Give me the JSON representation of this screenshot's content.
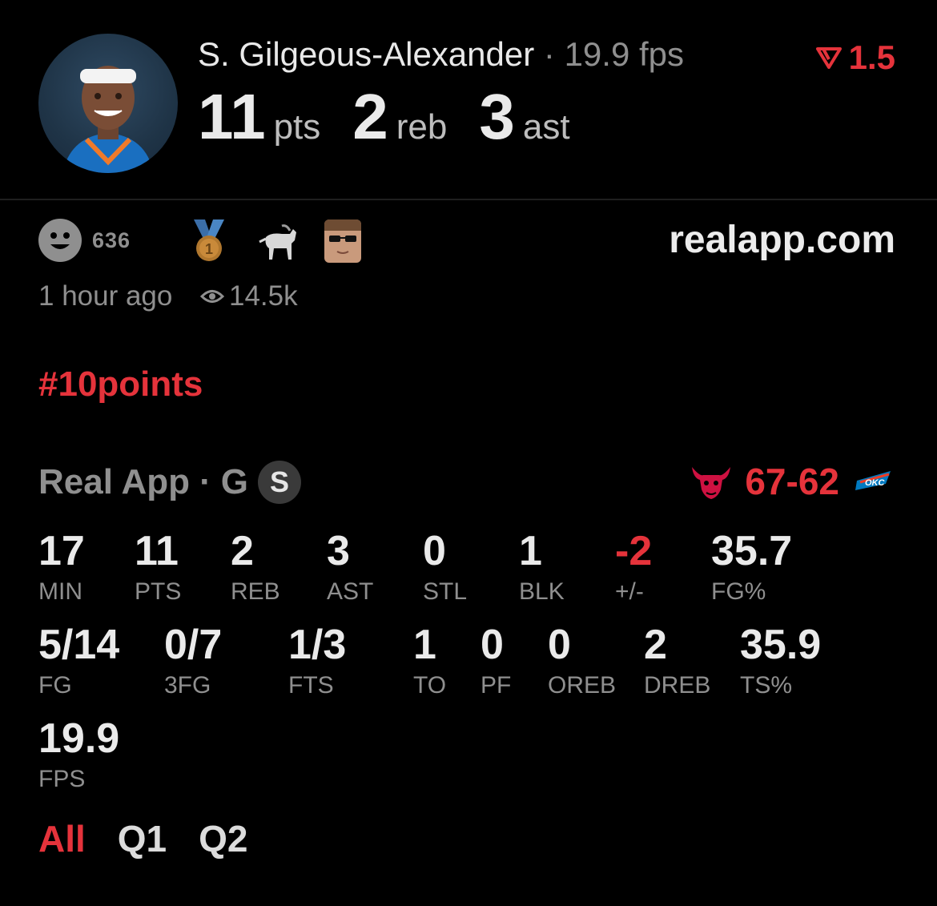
{
  "header": {
    "player_name": "S. Gilgeous-Alexander",
    "separator": "·",
    "fps_text": "19.9 fps",
    "delta": "1.5",
    "big_stats": [
      {
        "value": "11",
        "unit": "pts"
      },
      {
        "value": "2",
        "unit": "reb"
      },
      {
        "value": "3",
        "unit": "ast"
      }
    ]
  },
  "reactions": {
    "count": "636",
    "site": "realapp.com",
    "time": "1 hour ago",
    "views": "14.5k"
  },
  "hashtag": "#10points",
  "game": {
    "league": "Real App",
    "separator": "·",
    "position": "G",
    "badge": "S",
    "score_home": "67",
    "score_dash": "-",
    "score_away": "62"
  },
  "stats": [
    {
      "v": "17",
      "l": "MIN"
    },
    {
      "v": "11",
      "l": "PTS"
    },
    {
      "v": "2",
      "l": "REB"
    },
    {
      "v": "3",
      "l": "AST"
    },
    {
      "v": "0",
      "l": "STL"
    },
    {
      "v": "1",
      "l": "BLK"
    },
    {
      "v": "-2",
      "l": "+/-"
    },
    {
      "v": "35.7",
      "l": "FG%"
    },
    {
      "v": "5/14",
      "l": "FG"
    },
    {
      "v": "0/7",
      "l": "3FG"
    },
    {
      "v": "1/3",
      "l": "FTS"
    },
    {
      "v": "1",
      "l": "TO"
    },
    {
      "v": "0",
      "l": "PF"
    },
    {
      "v": "0",
      "l": "OREB"
    },
    {
      "v": "2",
      "l": "DREB"
    },
    {
      "v": "35.9",
      "l": "TS%"
    },
    {
      "v": "19.9",
      "l": "FPS"
    }
  ],
  "tabs": [
    "All",
    "Q1",
    "Q2"
  ],
  "colors": {
    "accent_red": "#e5333b",
    "muted": "#8f8f8f",
    "background": "#000000"
  }
}
